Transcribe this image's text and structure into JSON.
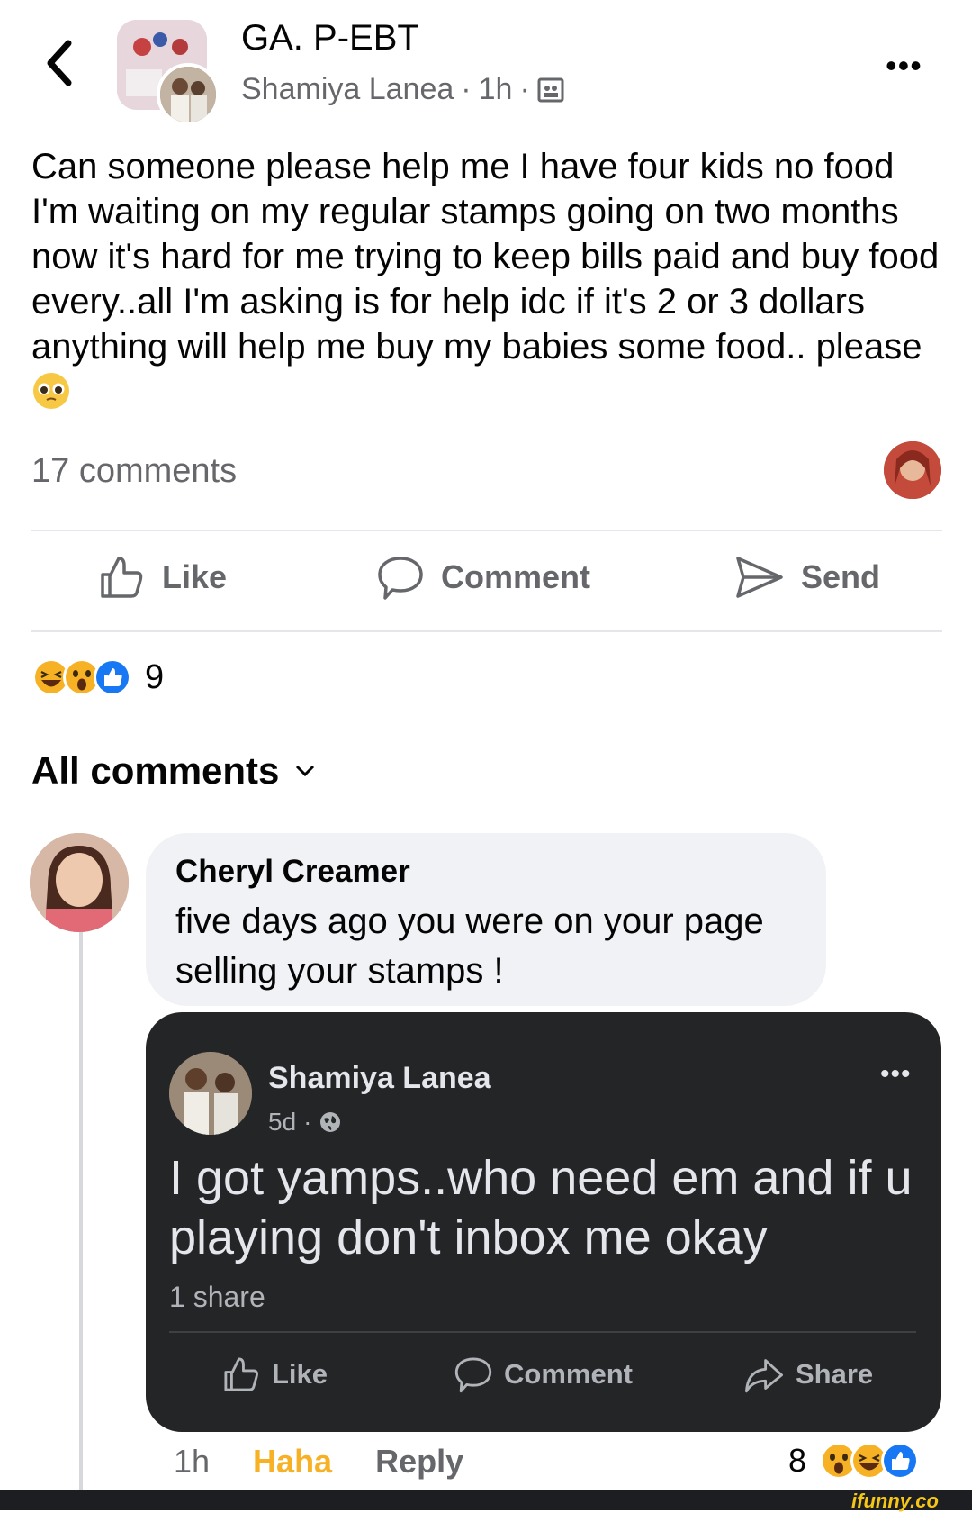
{
  "header": {
    "group_name": "GA. P-EBT",
    "author": "Shamiya Lanea",
    "time": "1h",
    "separator": "·",
    "more": "•••"
  },
  "post": {
    "text": "Can someone please help me I have four kids no food I'm waiting on my regular stamps going on two months now it's hard for me trying to keep bills paid and buy food every..all I'm asking is for help idc if it's 2 or 3 dollars anything will help me buy my babies some food.. please",
    "comments_count": "17 comments"
  },
  "actions": {
    "like": "Like",
    "comment": "Comment",
    "send": "Send"
  },
  "reactions": {
    "count": "9",
    "types": [
      "haha",
      "wow",
      "like"
    ]
  },
  "comments_header": "All comments",
  "comment": {
    "author": "Cheryl Creamer",
    "text": "five days ago you were on your page selling your stamps !",
    "time": "1h",
    "haha": "Haha",
    "reply": "Reply",
    "reaction_count": "8",
    "reaction_types": [
      "wow",
      "haha",
      "like"
    ]
  },
  "shared_post": {
    "author": "Shamiya Lanea",
    "time": "5d",
    "separator": "·",
    "text": "I got yamps..who need em and if u playing don't inbox me okay",
    "shares": "1 share",
    "more": "•••",
    "actions": {
      "like": "Like",
      "comment": "Comment",
      "share": "Share"
    }
  },
  "watermark": "ifunny.co",
  "colors": {
    "haha": "#f7b125",
    "like_blue": "#1877f2",
    "dark_card": "#242526"
  }
}
